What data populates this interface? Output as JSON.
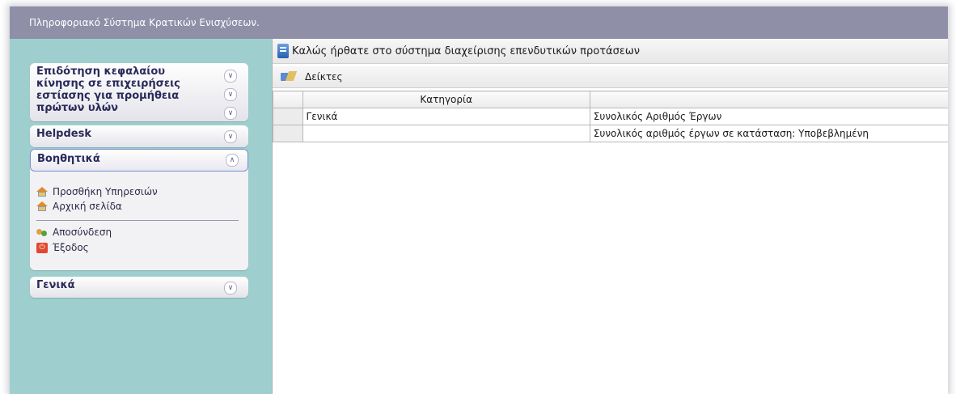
{
  "header": {
    "title": "Πληροφοριακό Σύστημα Κρατικών Ενισχύσεων."
  },
  "sidebar": {
    "panels": [
      {
        "title": "Επιδότηση κεφαλαίου κίνησης σε επιχειρήσεις εστίασης για προμήθεια πρώτων υλών",
        "expanded": false
      },
      {
        "title": "Helpdesk",
        "expanded": false
      },
      {
        "title": "Βοηθητικά",
        "expanded": true,
        "items": [
          {
            "label": "Προσθήκη Υπηρεσιών",
            "icon": "house-icon"
          },
          {
            "label": "Αρχική σελίδα",
            "icon": "house-icon"
          },
          {
            "label": "Αποσύνδεση",
            "icon": "users-icon"
          },
          {
            "label": "Έξοδος",
            "icon": "power-icon"
          }
        ]
      },
      {
        "title": "Γενικά",
        "expanded": false
      }
    ]
  },
  "main": {
    "welcome": "Καλώς ήρθατε στο σύστημα διαχείρισης επενδυτικών προτάσεων",
    "section_title": "Δείκτες",
    "table": {
      "headers": [
        "",
        "Κατηγορία",
        ""
      ],
      "rows": [
        [
          "",
          "Γενικά",
          "Συνολικός Αριθμός Έργων"
        ],
        [
          "",
          "",
          "Συνολικός αριθμός έργων σε κατάσταση: Υποβεβλημένη"
        ]
      ]
    }
  },
  "colors": {
    "topbar": "#8f8fa8",
    "sidebar": "#9ecfce",
    "panel_accent": "#7a8fd0"
  }
}
